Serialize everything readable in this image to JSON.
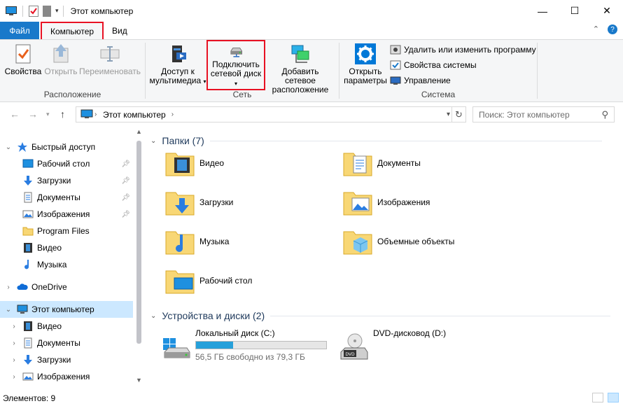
{
  "window": {
    "title": "Этот компьютер",
    "controls": [
      "—",
      "☐",
      "✕"
    ]
  },
  "tabs": [
    "Файл",
    "Компьютер",
    "Вид"
  ],
  "ribbon": {
    "location": {
      "label": "Расположение",
      "properties": "Свойства",
      "open": "Открыть",
      "rename": "Переименовать"
    },
    "network": {
      "label": "Сеть",
      "media_line1": "Доступ к",
      "media_line2": "мультимедиа",
      "map_line1": "Подключить",
      "map_line2": "сетевой диск",
      "addloc_line1": "Добавить сетевое",
      "addloc_line2": "расположение"
    },
    "system": {
      "label": "Система",
      "settings_line1": "Открыть",
      "settings_line2": "параметры",
      "uninstall": "Удалить или изменить программу",
      "sysprops": "Свойства системы",
      "manage": "Управление"
    }
  },
  "address": {
    "path": "Этот компьютер",
    "search_placeholder": "Поиск: Этот компьютер"
  },
  "nav": {
    "quick_access": "Быстрый доступ",
    "quick_items": [
      "Рабочий стол",
      "Загрузки",
      "Документы",
      "Изображения",
      "Program Files",
      "Видео",
      "Музыка"
    ],
    "onedrive": "OneDrive",
    "this_pc": "Этот компьютер",
    "pc_items": [
      "Видео",
      "Документы",
      "Загрузки",
      "Изображения"
    ]
  },
  "content": {
    "folders_header": "Папки (7)",
    "folders": [
      "Видео",
      "Документы",
      "Загрузки",
      "Изображения",
      "Музыка",
      "Объемные объекты",
      "Рабочий стол"
    ],
    "devices_header": "Устройства и диски (2)",
    "drives": [
      {
        "name": "Локальный диск (C:)",
        "free": "56,5 ГБ свободно из 79,3 ГБ",
        "used_fraction": 0.287
      },
      {
        "name": "DVD-дисковод (D:)"
      }
    ]
  },
  "status": {
    "items": "Элементов: 9"
  },
  "colors": {
    "accent": "#1979ca",
    "highlight": "#e81123",
    "selected": "#cce8ff",
    "folder": "#f8d775"
  }
}
